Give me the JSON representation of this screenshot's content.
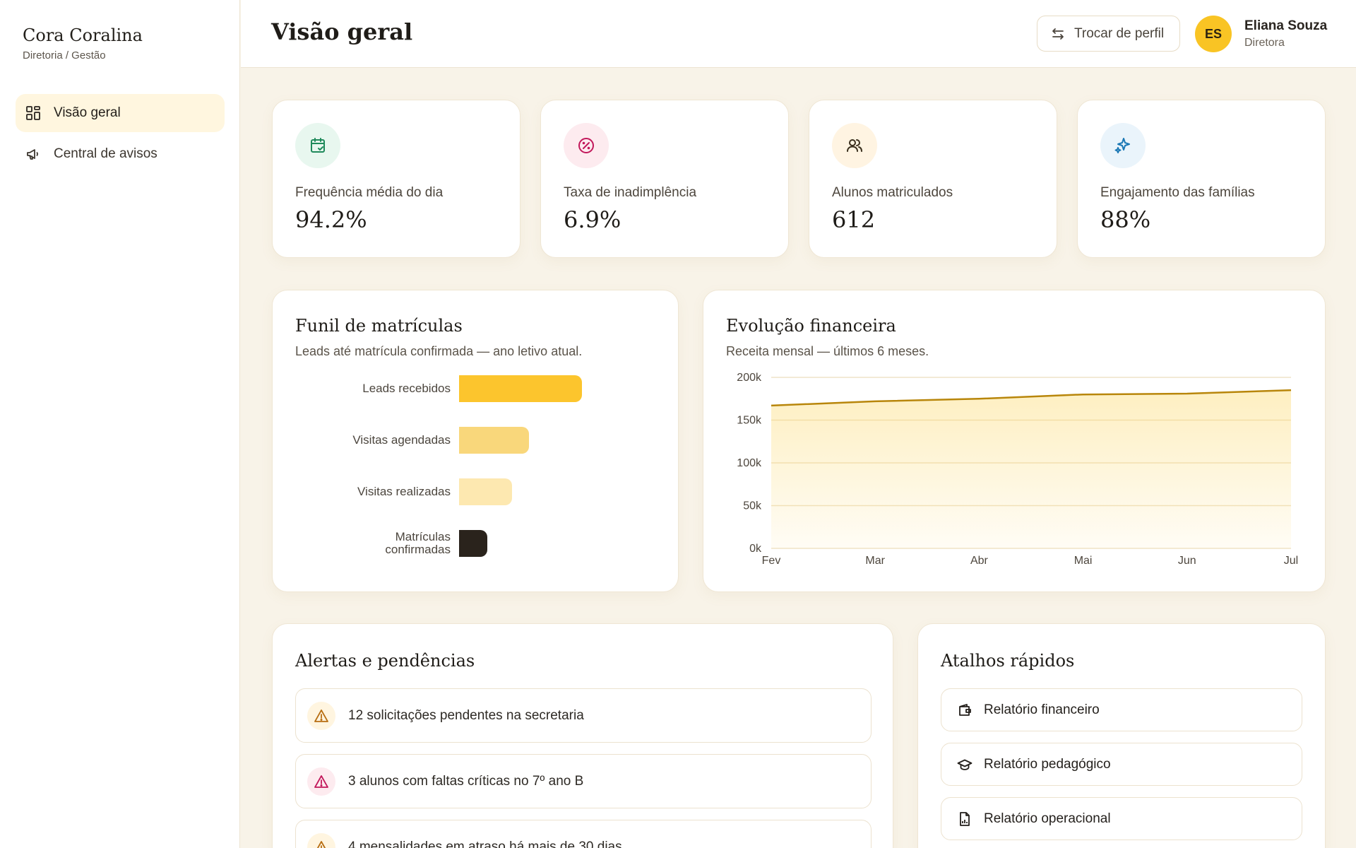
{
  "sidebar": {
    "brand_name": "Cora Coralina",
    "brand_sub": "Diretoria / Gestão",
    "items": [
      {
        "label": "Visão geral",
        "icon": "grid-icon",
        "active": true
      },
      {
        "label": "Central de avisos",
        "icon": "megaphone-icon",
        "active": false
      }
    ]
  },
  "header": {
    "title": "Visão geral",
    "switch_label": "Trocar de perfil",
    "avatar_initials": "ES",
    "user_name": "Eliana Souza",
    "user_role": "Diretora"
  },
  "kpis": [
    {
      "label": "Frequência média do dia",
      "value": "94.2%",
      "icon": "calendar-check-icon",
      "color": "#1f8a5b"
    },
    {
      "label": "Taxa de inadimplência",
      "value": "6.9%",
      "icon": "percent-badge-icon",
      "color": "#c2185b"
    },
    {
      "label": "Alunos matriculados",
      "value": "612",
      "icon": "users-icon",
      "color": "#3a2f1d"
    },
    {
      "label": "Engajamento das famílias",
      "value": "88%",
      "icon": "sparkles-icon",
      "color": "#1b78b5"
    }
  ],
  "funnel": {
    "title": "Funil de matrículas",
    "subtitle": "Leads até matrícula confirmada — ano letivo atual.",
    "chart_data": {
      "type": "bar",
      "orientation": "horizontal",
      "categories": [
        "Leads recebidos",
        "Visitas agendadas",
        "Visitas realizadas",
        "Matrículas confirmadas"
      ],
      "label_lines": [
        [
          "Leads recebidos"
        ],
        [
          "Visitas agendadas"
        ],
        [
          "Visitas realizadas"
        ],
        [
          "Matrículas",
          "confirmadas"
        ]
      ],
      "values": [
        100,
        57,
        43,
        23
      ],
      "colors": [
        "#fcc52d",
        "#f9d77b",
        "#fde8b0",
        "#2a231c"
      ]
    }
  },
  "finance": {
    "title": "Evolução financeira",
    "subtitle": "Receita mensal — últimos 6 meses.",
    "chart_data": {
      "type": "area",
      "categories": [
        "Fev",
        "Mar",
        "Abr",
        "Mai",
        "Jun",
        "Jul"
      ],
      "values": [
        167000,
        172000,
        175000,
        180000,
        181000,
        185000
      ],
      "y_ticks": [
        "0k",
        "50k",
        "100k",
        "150k",
        "200k"
      ],
      "ylim": [
        0,
        200000
      ],
      "grid": true,
      "line_color": "#b8860b",
      "fill_color": "#fcd55c"
    }
  },
  "alerts": {
    "title": "Alertas e pendências",
    "items": [
      {
        "text": "12 solicitações pendentes na secretaria",
        "color": "#b86e12",
        "bg": "#fff5e0"
      },
      {
        "text": "3 alunos com faltas críticas no 7º ano B",
        "color": "#c2185b",
        "bg": "#fdebef"
      },
      {
        "text": "4 mensalidades em atraso há mais de 30 dias",
        "color": "#b86e12",
        "bg": "#fff5e0"
      }
    ]
  },
  "shortcuts": {
    "title": "Atalhos rápidos",
    "items": [
      {
        "label": "Relatório financeiro",
        "icon": "wallet-icon"
      },
      {
        "label": "Relatório pedagógico",
        "icon": "graduation-cap-icon"
      },
      {
        "label": "Relatório operacional",
        "icon": "document-chart-icon"
      }
    ]
  }
}
